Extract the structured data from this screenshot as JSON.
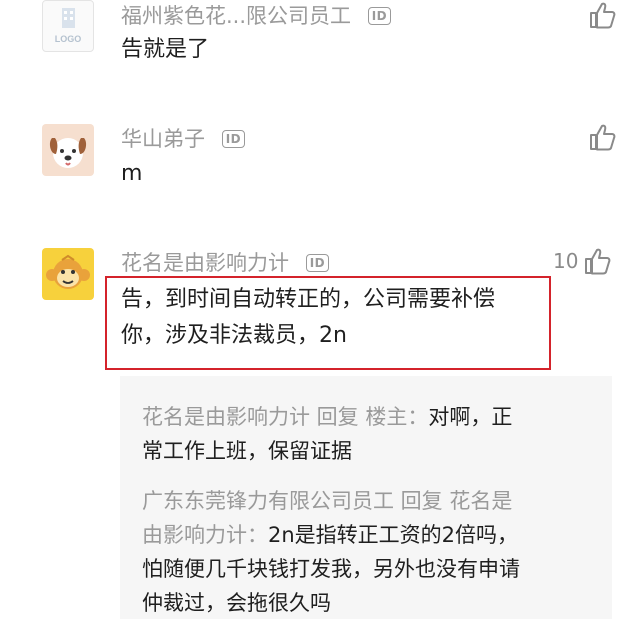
{
  "comments": [
    {
      "author": "福州紫色花...限公司员工",
      "id_badge": "ID",
      "avatar_text": "LOGO",
      "text": "告就是了",
      "likes": ""
    },
    {
      "author": "华山弟子",
      "id_badge": "ID",
      "text": "m",
      "likes": ""
    },
    {
      "author": "花名是由影响力计",
      "id_badge": "ID",
      "text_line1": "告，到时间自动转正的，公司需要补偿",
      "text_line2": "你，涉及非法裁员，2n",
      "likes": "10"
    }
  ],
  "replies": [
    {
      "line1_who": "花名是由影响力计 回复 楼主：",
      "line1_text": "对啊，正",
      "line2_text": "常工作上班，保留证据"
    },
    {
      "line1_who": "广东东莞锋力有限公司员工 回复 花名是",
      "line2_who": "由影响力计：",
      "line2_text": "2n是指转正工资的2倍吗，",
      "line3_text": "怕随便几千块钱打发我，另外也没有申请",
      "line4_text": "仲裁过，会拖很久吗"
    }
  ],
  "colors": {
    "highlight_border": "#d4232b",
    "name_gray": "#9a9a9a",
    "reply_bg": "#f6f6f6"
  }
}
